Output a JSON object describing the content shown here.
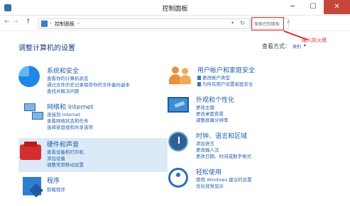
{
  "window": {
    "title": "控制面板",
    "minimize": "─",
    "maximize": "☐",
    "close": "✕"
  },
  "nav": {
    "back": "←",
    "forward": "→",
    "up": "↑",
    "breadcrumb": "控制面板",
    "breadcrumb_sep": "›",
    "dropdown": "▾",
    "refresh": "↻",
    "search_placeholder": "搜索控制面板",
    "search_go": "⌕"
  },
  "header": {
    "title": "调整计算机的设置",
    "view_by_label": "查看方式：",
    "view_by_value": "类别",
    "view_by_arrow": "▾"
  },
  "annotation": {
    "text": "输入防火墙",
    "color": "#e0312b"
  },
  "categories": [
    {
      "name": "system-security",
      "icon": "pie-chart-icon",
      "title": "系统和安全",
      "links": [
        "查看你的计算机状态",
        "通过文件历史记录保存你的文件备份副本",
        "查找并解决问题"
      ]
    },
    {
      "name": "network-internet",
      "icon": "network-icon",
      "title": "网络和 Internet",
      "links": [
        "连接到 Internet",
        "查看网络状态和任务",
        "选择家庭组和共享选项"
      ]
    },
    {
      "name": "hardware-sound",
      "icon": "printer-icon",
      "title": "硬件和声音",
      "links": [
        "查看设备和打印机",
        "添加设备",
        "调整常用移动设置"
      ]
    },
    {
      "name": "programs",
      "icon": "programs-icon",
      "title": "程序",
      "links": [
        "卸载程序"
      ]
    },
    {
      "name": "user-accounts",
      "icon": "users-icon",
      "title": "用户帐户和家庭安全",
      "links": [
        "更改帐户类型",
        "为所有用户设置家庭安全"
      ]
    },
    {
      "name": "appearance",
      "icon": "appearance-icon",
      "title": "外观和个性化",
      "links": [
        "更改主题",
        "更改桌面背景",
        "调整屏幕分辨率"
      ]
    },
    {
      "name": "clock-region",
      "icon": "clock-globe-icon",
      "title": "时钟、语言和区域",
      "links": [
        "添加语言",
        "更改输入法",
        "更改日期、时间或数字格式"
      ]
    },
    {
      "name": "ease-of-access",
      "icon": "accessibility-icon",
      "title": "轻松使用",
      "links": [
        "使用 Windows 建议的设置",
        "优化视觉显示"
      ]
    }
  ],
  "colors": {
    "link": "#2a62b0",
    "heading": "#1f5ea8",
    "highlight": "#dceaf7",
    "close_button": "#c7463a"
  }
}
